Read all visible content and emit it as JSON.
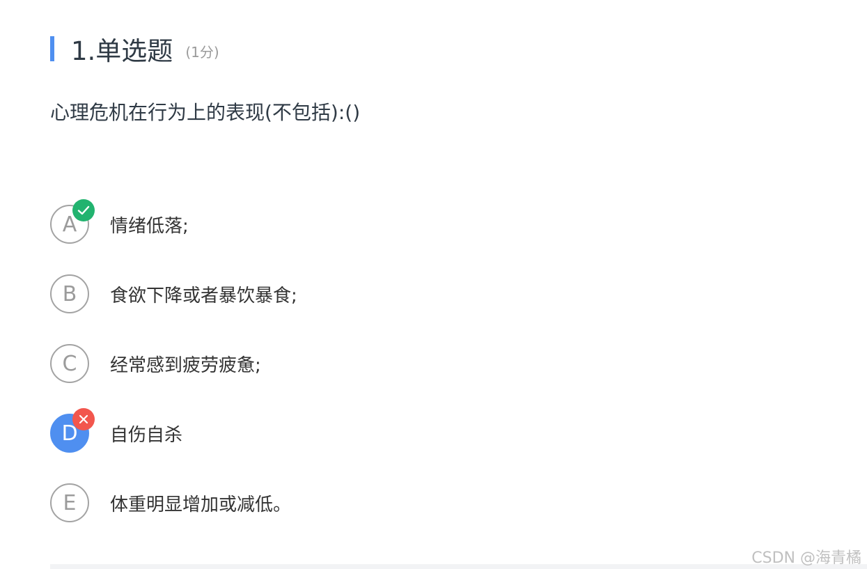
{
  "question": {
    "title": "1.单选题",
    "score": "(1分)",
    "stem": "心理危机在行为上的表现(不包括):()"
  },
  "options": [
    {
      "letter": "A",
      "text": "情绪低落;",
      "status": "correct"
    },
    {
      "letter": "B",
      "text": "食欲下降或者暴饮暴食;",
      "status": ""
    },
    {
      "letter": "C",
      "text": "经常感到疲劳疲惫;",
      "status": ""
    },
    {
      "letter": "D",
      "text": "自伤自杀",
      "status": "wrong-selected"
    },
    {
      "letter": "E",
      "text": "体重明显增加或减低。",
      "status": ""
    }
  ],
  "watermark": "CSDN @海青橘",
  "colors": {
    "accent": "#4f8ff0",
    "correct": "#22b36f",
    "wrong": "#f2564d"
  }
}
